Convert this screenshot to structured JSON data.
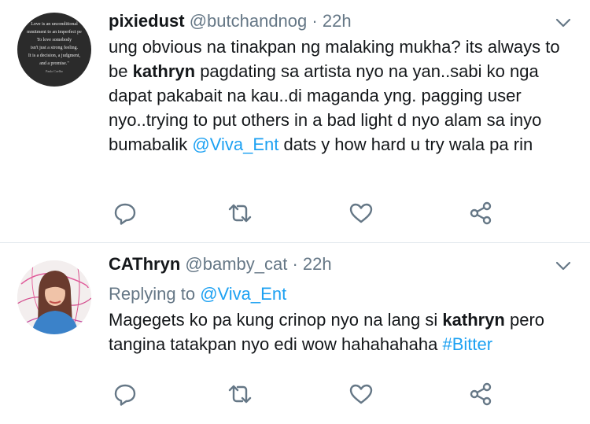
{
  "tweets": [
    {
      "display_name": "pixiedust",
      "handle": "@butchandnog",
      "separator": "·",
      "time": "22h",
      "avatar_quote": [
        "Love is an unconditional",
        "mmitment to an imperfect pe",
        "To love somebody",
        "isn't just a strong feeling.",
        "It is a decision, a judgment,",
        "and a promise.\"",
        "Paulo Coelho"
      ],
      "text": {
        "p1": "ung obvious na tinakpan ng malaking mukha? its always to be ",
        "bold1": "kathryn",
        "p2": " pagdating sa artista nyo na yan..sabi ko nga dapat pakabait na  kau..di maganda yng. pagging user nyo..trying to put others in a bad light d nyo alam sa inyo bumabalik ",
        "mention": "@Viva_Ent",
        "p3": " dats y how hard u try wala pa rin"
      }
    },
    {
      "display_name": "CAThryn",
      "handle": "@bamby_cat",
      "separator": "·",
      "time": "22h",
      "replying_prefix": "Replying to ",
      "replying_to": "@Viva_Ent",
      "text": {
        "p1": "Magegets ko pa kung crinop nyo na lang si ",
        "bold1": "kathryn",
        "p2": " pero tangina tatakpan nyo edi wow hahahahaha ",
        "hashtag": "#Bitter"
      }
    }
  ],
  "icons": {
    "menu": "chevron-down-icon",
    "reply": "comment-bubble-icon",
    "retweet": "retweet-icon",
    "like": "heart-icon",
    "share": "share-icon"
  },
  "colors": {
    "text": "#14171a",
    "secondary": "#657786",
    "link": "#1da1f2",
    "divider": "#e1e8ed"
  }
}
